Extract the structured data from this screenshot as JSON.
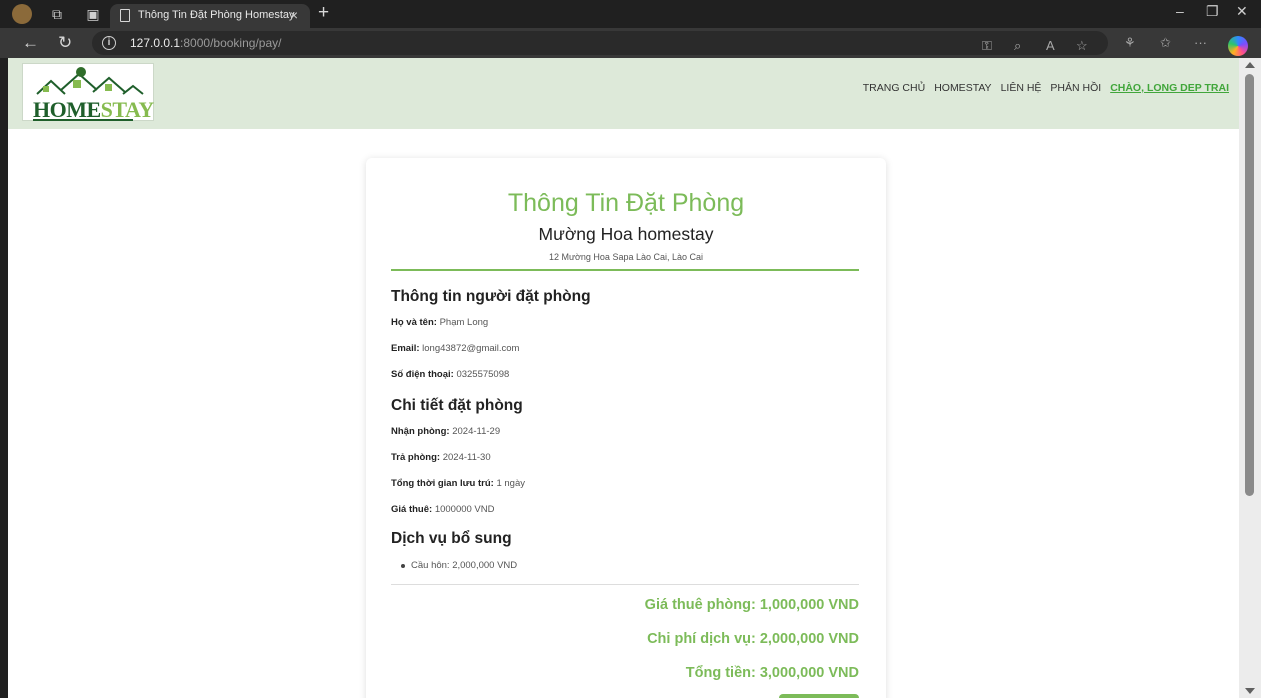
{
  "browser": {
    "tab_title": "Thông Tin Đặt Phòng Homestay",
    "tab_close": "×",
    "new_tab": "+",
    "url_host": "127.0.0.1",
    "url_rest": ":8000/booking/pay/"
  },
  "header": {
    "logo_home": "HOME",
    "logo_stay": "STAY",
    "nav": [
      "TRANG CHỦ",
      "HOMESTAY",
      "LIÊN HỆ",
      "PHẢN HỒI"
    ],
    "greeting": "CHÀO, LONG DEP TRAI"
  },
  "booking": {
    "title": "Thông Tin Đặt Phòng",
    "homestay_name": "Mường Hoa homestay",
    "address": "12 Mường Hoa Sapa Lào Cai, Lào Cai",
    "guest_section": "Thông tin người đặt phòng",
    "name_label": "Họ và tên:",
    "name_value": "Phạm Long",
    "email_label": "Email:",
    "email_value": "long43872@gmail.com",
    "phone_label": "Số điện thoại:",
    "phone_value": "0325575098",
    "detail_section": "Chi tiết đặt phòng",
    "checkin_label": "Nhận phòng:",
    "checkin_value": "2024-11-29",
    "checkout_label": "Trả phòng:",
    "checkout_value": "2024-11-30",
    "duration_label": "Tổng thời gian lưu trú:",
    "duration_value": "1 ngày",
    "price_label": "Giá thuê:",
    "price_value": "1000000 VND",
    "services_section": "Dịch vụ bổ sung",
    "services": [
      "Cầu hôn: 2,000,000 VND"
    ],
    "room_total": "Giá thuê phòng: 1,000,000 VND",
    "service_total": "Chi phí dịch vụ: 2,000,000 VND",
    "grand_total": "Tổng tiền: 3,000,000 VND"
  },
  "colors": {
    "accent": "#7cbb59",
    "header_bg": "#dde9d9",
    "greeting": "#41a63b"
  }
}
